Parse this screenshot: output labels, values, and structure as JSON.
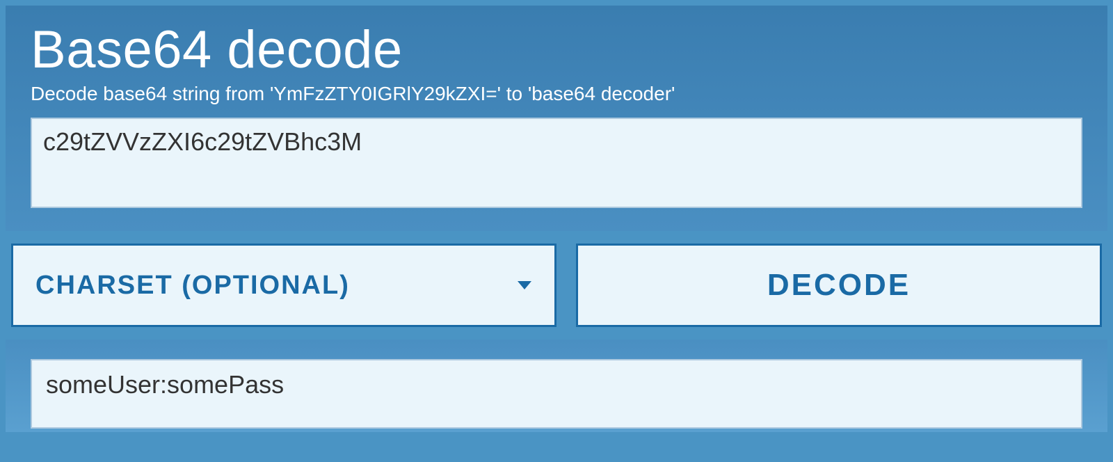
{
  "header": {
    "title": "Base64 decode",
    "subtitle": "Decode base64 string from 'YmFzZTY0IGRlY29kZXI=' to 'base64 decoder'"
  },
  "input": {
    "value": "c29tZVVzZXI6c29tZVBhc3M"
  },
  "controls": {
    "charset_label": "CHARSET (OPTIONAL)",
    "decode_label": "DECODE"
  },
  "output": {
    "value": "someUser:somePass"
  }
}
